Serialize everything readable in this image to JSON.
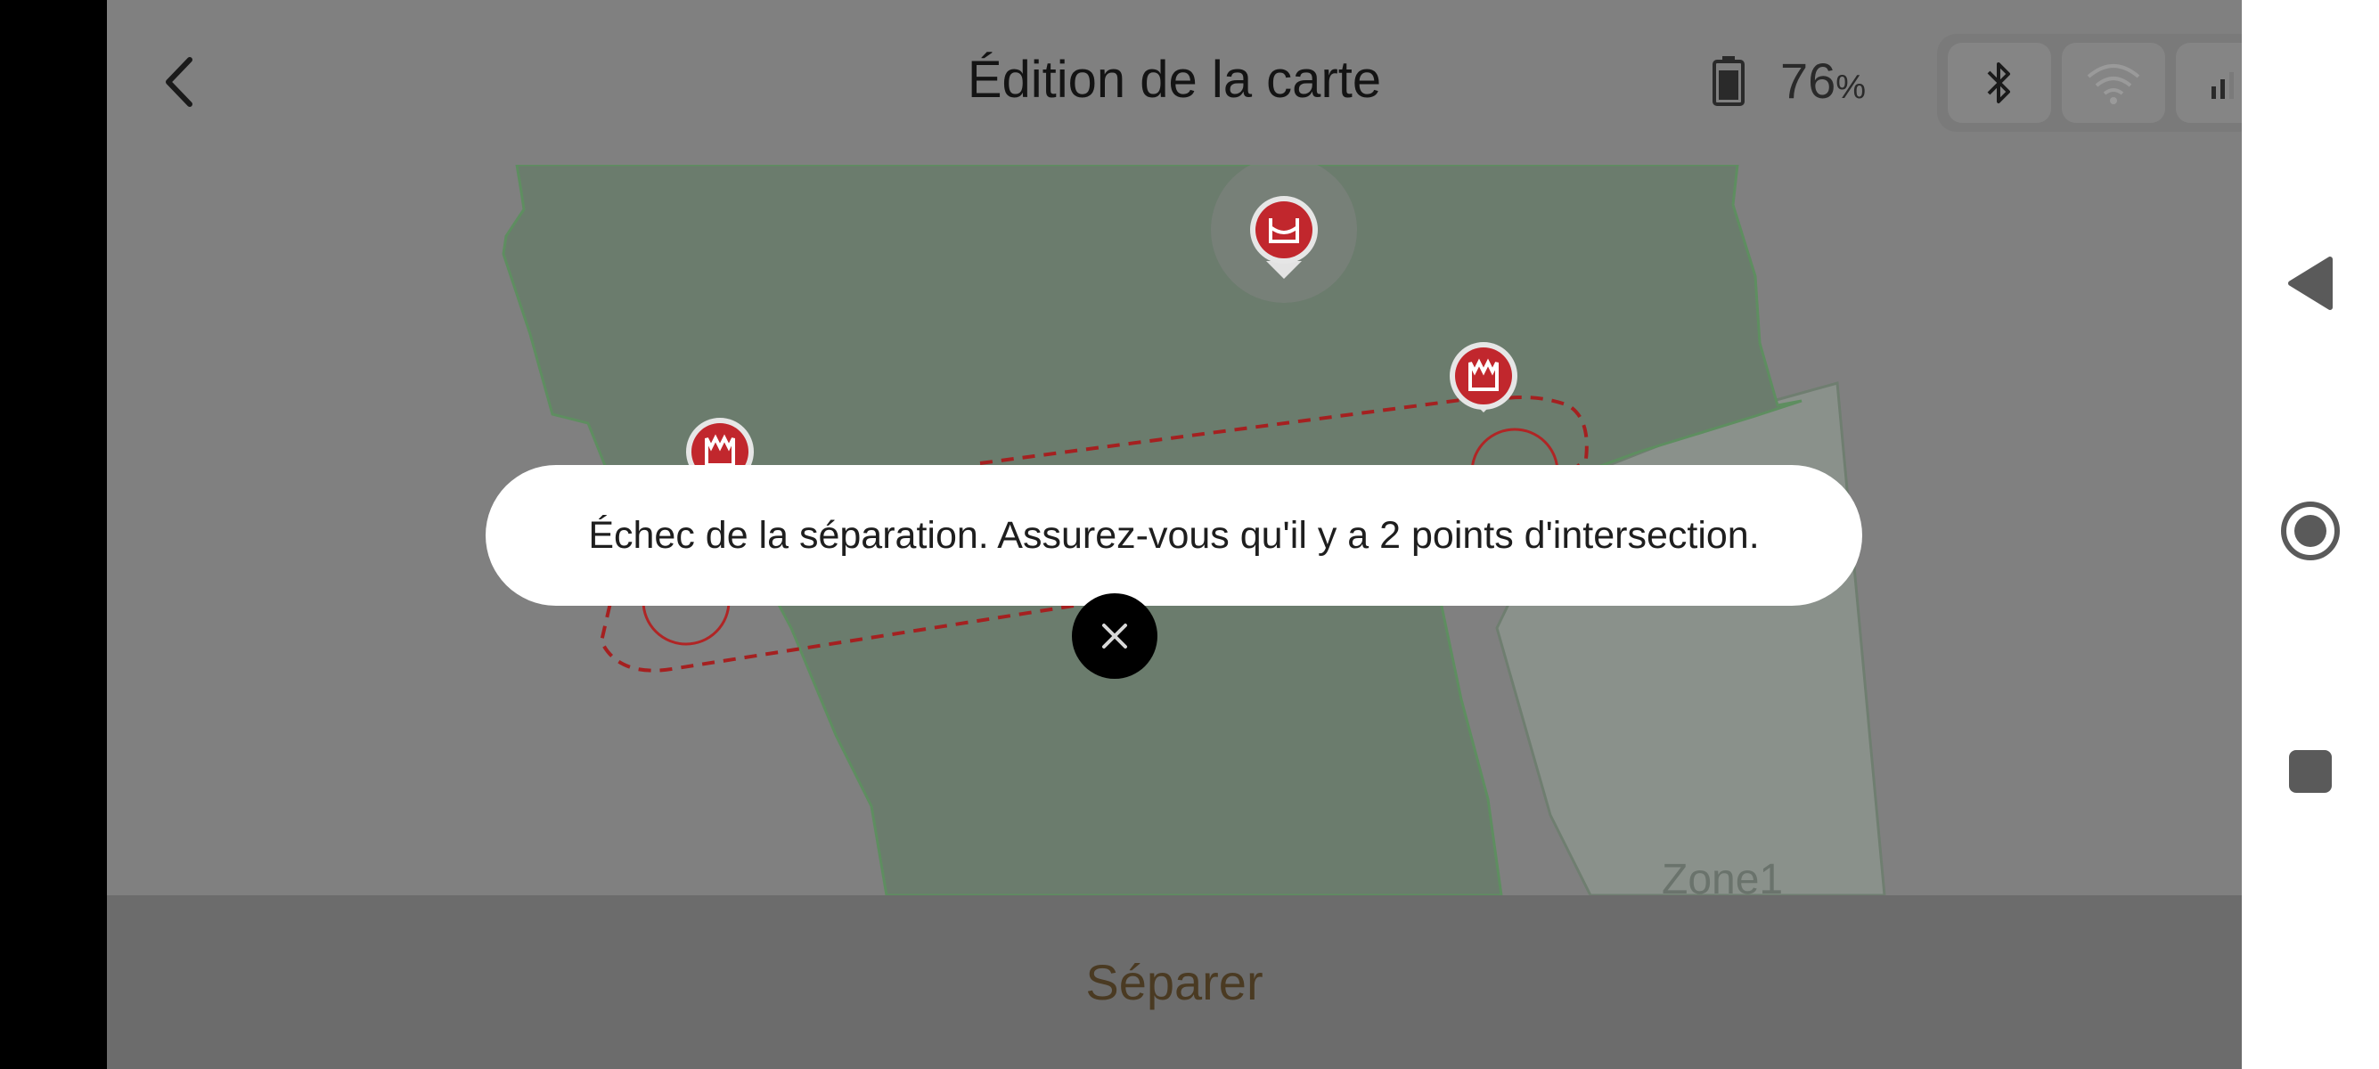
{
  "header": {
    "title": "Édition de la carte",
    "battery_percent": "76",
    "battery_unit": "%"
  },
  "map": {
    "zone_label": "Zone1"
  },
  "toast": {
    "message": "Échec de la séparation. Assurez-vous qu'il y a 2 points d'intersection."
  },
  "footer": {
    "separate_label": "Séparer"
  },
  "icons": {
    "back": "chevron-left-icon",
    "battery": "battery-icon",
    "bluetooth": "bluetooth-icon",
    "wifi": "wifi-icon",
    "signal": "signal-icon",
    "marker_top": "base-station-icon",
    "marker_tower": "tower-icon",
    "close": "close-icon"
  },
  "colors": {
    "overlay": "#808080",
    "zone_fill": "#6b7c6d",
    "marker_red": "#c1272d",
    "dashed_line": "#a52020",
    "accent_text": "#4a3a22"
  }
}
